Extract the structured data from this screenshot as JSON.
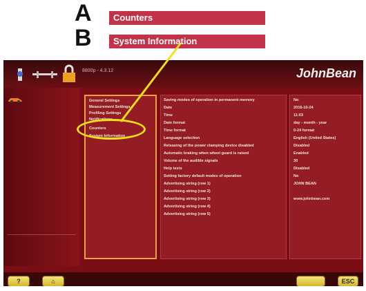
{
  "callouts": {
    "a_letter": "A",
    "b_letter": "B",
    "a_label": "Counters",
    "b_label": "System Information"
  },
  "app": {
    "logo": "JohnBean",
    "version": "8800p - 4.3.12"
  },
  "menu": {
    "items": [
      "General Settings",
      "Measurement Settings",
      "Profiling Settings",
      "Notifications",
      "Counters",
      "System Information"
    ]
  },
  "settings": {
    "labels": [
      "Saving modes of operation in permanent memory",
      "Date",
      "Time",
      "Date format",
      "Time format",
      "Language selection",
      "Releasing of the power clamping device disabled",
      "Automatic braking when wheel guard is raised",
      "Volume of the audible signals",
      "Help texts",
      "Setting factory default modes of operation",
      "Advertising string (row 1)",
      "Advertising string (row 2)",
      "Advertising string (row 3)",
      "Advertising string (row 4)",
      "Advertising string (row 5)"
    ],
    "values": [
      "No",
      "2016-10-24",
      "11:03",
      "day - month - year",
      "0-24 format",
      "English (United States)",
      "Disabled",
      "Enabled",
      "30",
      "Disabled",
      "No",
      "JOHN BEAN",
      "",
      "www.johnbean.com",
      "",
      ""
    ]
  },
  "buttons": {
    "help": "?",
    "home": "",
    "confirm": "",
    "esc": "ESC"
  },
  "colors": {
    "accent": "#c2334a",
    "highlight": "#f4e01a",
    "screen": "#7a0e14"
  }
}
